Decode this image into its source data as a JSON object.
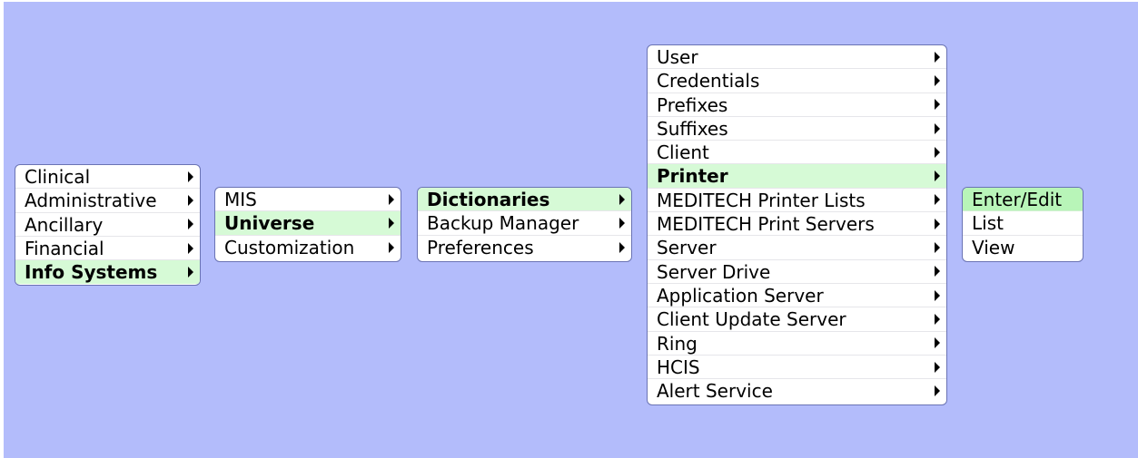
{
  "menus": {
    "level1": {
      "items": [
        {
          "label": "Clinical"
        },
        {
          "label": "Administrative"
        },
        {
          "label": "Ancillary"
        },
        {
          "label": "Financial"
        },
        {
          "label": "Info Systems"
        }
      ],
      "selected": "Info Systems"
    },
    "level2": {
      "items": [
        {
          "label": "MIS"
        },
        {
          "label": "Universe"
        },
        {
          "label": "Customization"
        }
      ],
      "selected": "Universe"
    },
    "level3": {
      "items": [
        {
          "label": "Dictionaries"
        },
        {
          "label": "Backup Manager"
        },
        {
          "label": "Preferences"
        }
      ],
      "selected": "Dictionaries"
    },
    "level4": {
      "items": [
        {
          "label": "User"
        },
        {
          "label": "Credentials"
        },
        {
          "label": "Prefixes"
        },
        {
          "label": "Suffixes"
        },
        {
          "label": "Client"
        },
        {
          "label": "Printer"
        },
        {
          "label": "MEDITECH Printer Lists"
        },
        {
          "label": "MEDITECH Print Servers"
        },
        {
          "label": "Server"
        },
        {
          "label": "Server Drive"
        },
        {
          "label": "Application Server"
        },
        {
          "label": "Client Update Server"
        },
        {
          "label": "Ring"
        },
        {
          "label": "HCIS"
        },
        {
          "label": "Alert Service"
        }
      ],
      "selected": "Printer"
    },
    "level5": {
      "items": [
        {
          "label": "Enter/Edit"
        },
        {
          "label": "List"
        },
        {
          "label": "View"
        }
      ],
      "highlighted": "Enter/Edit"
    }
  },
  "colors": {
    "background": "#b3bcfb",
    "menu_border": "#6a73b4",
    "selected_bg": "#d6fad6",
    "highlight_bg": "#b8f5b8"
  }
}
